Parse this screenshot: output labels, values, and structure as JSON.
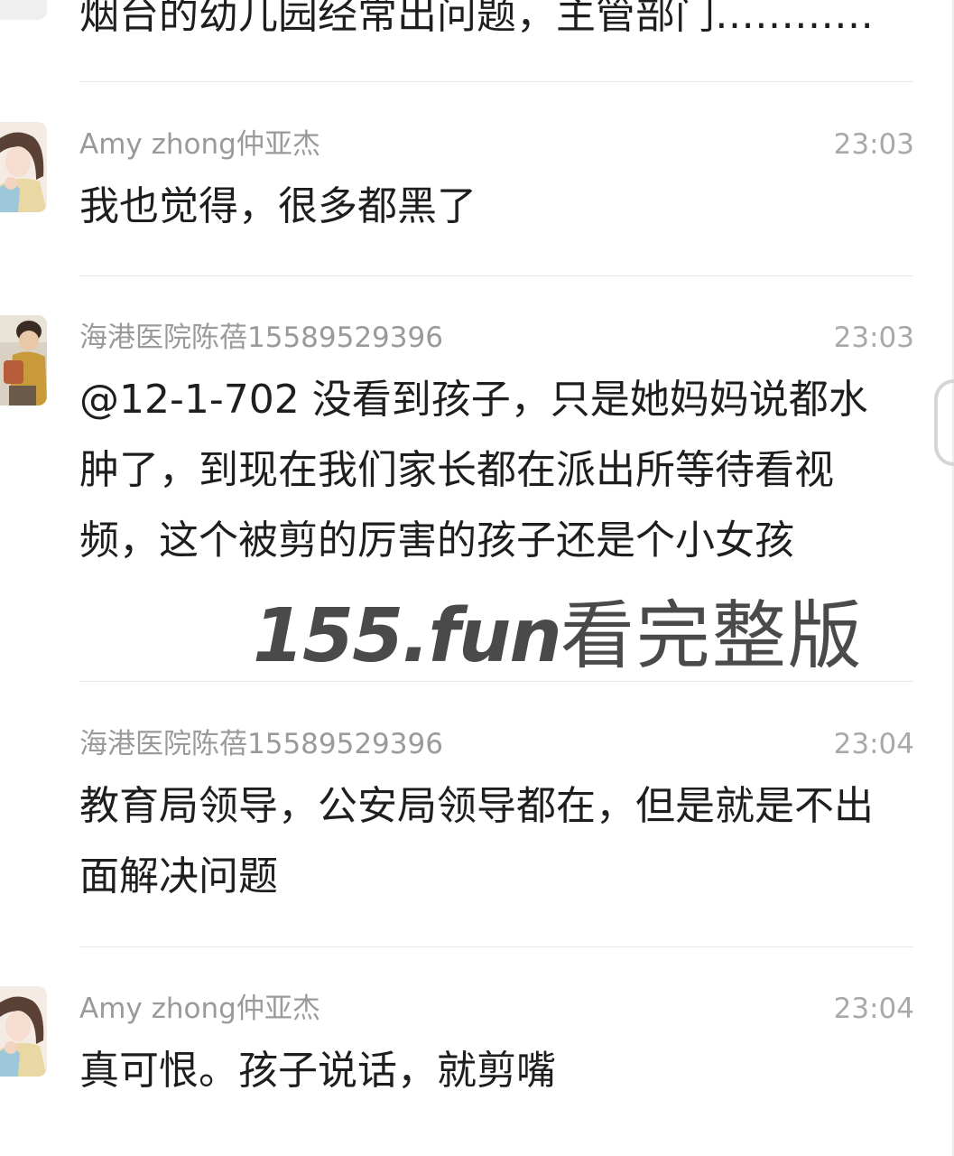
{
  "messages": [
    {
      "sender": "",
      "time": "",
      "content": "烟台的幼儿园经常出问题，主管部门…………"
    },
    {
      "sender": "Amy zhong仲亚杰",
      "time": "23:03",
      "content": "我也觉得，很多都黑了",
      "avatar": "woman-hugging-child-avatar"
    },
    {
      "sender": "海港医院陈蓓15589529396",
      "time": "23:03",
      "content": "@12-1-702 没看到孩子，只是她妈妈说都水肿了，到现在我们家长都在派出所等待看视频，这个被剪的厉害的孩子还是个小女孩",
      "avatar": "boy-with-toy-avatar"
    },
    {
      "sender": "海港医院陈蓓15589529396",
      "time": "23:04",
      "content": "教育局领导，公安局领导都在，但是就是不出面解决问题"
    },
    {
      "sender": "Amy zhong仲亚杰",
      "time": "23:04",
      "content": "真可恨。孩子说话，就剪嘴",
      "avatar": "woman-hugging-child-avatar"
    }
  ],
  "watermark": {
    "url": "155.fun",
    "cta": "看完整版"
  },
  "colors": {
    "sender": "#9a9a9a",
    "time": "#a9a9a9",
    "content": "#1e1e1e",
    "divider": "#e6e6e6",
    "background": "#ffffff"
  }
}
